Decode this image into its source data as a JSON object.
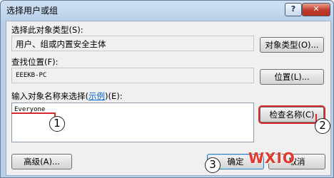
{
  "window": {
    "title": "选择用户或组",
    "help_glyph": "?",
    "close_glyph": "✕"
  },
  "object_type": {
    "label": "选择此对象类型(S):",
    "value": "用户、组或内置安全主体",
    "button_label": "对象类型(O)..."
  },
  "location": {
    "label": "查找位置(F):",
    "value": "EEEKB-PC",
    "button_label": "位置(L)..."
  },
  "names": {
    "label_prefix": "输入对象名称来选择(",
    "label_link": "示例",
    "label_suffix": ")(E):",
    "value": "Everyone",
    "check_button_label": "检查名称(C)"
  },
  "footer": {
    "advanced_label": "高级(A)...",
    "ok_label": "确定",
    "cancel_label": "取消"
  },
  "annotations": {
    "step1": "1",
    "step2": "2",
    "step3": "3",
    "accent_color": "#d8282f"
  },
  "watermark": {
    "text": "WXIO"
  }
}
